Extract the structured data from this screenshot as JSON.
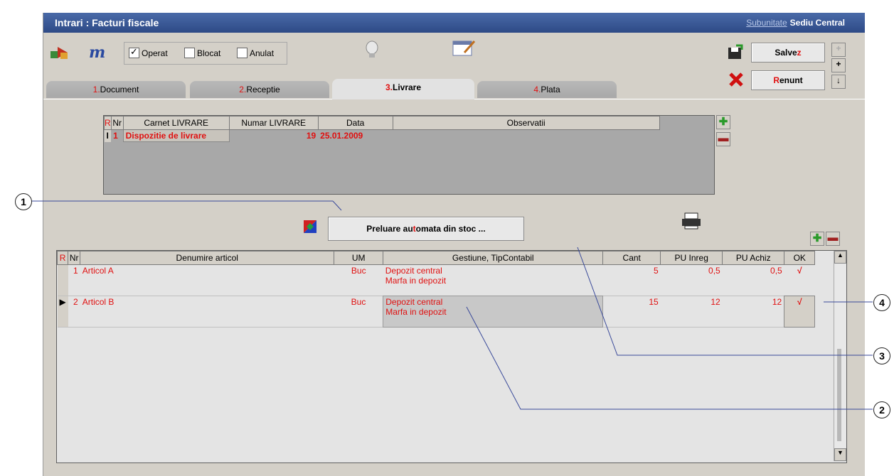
{
  "window": {
    "title": "Intrari : Facturi fiscale",
    "subunit_label": "Subunitate",
    "subunit_value": "Sediu Central"
  },
  "toolbar": {
    "checkboxes": [
      {
        "label": "Operat",
        "checked": true
      },
      {
        "label": "Blocat",
        "checked": false
      },
      {
        "label": "Anulat",
        "checked": false
      }
    ],
    "save_hot": "Salve",
    "save_rest": "z",
    "cancel_hot": "R",
    "cancel_rest": "enunt"
  },
  "tabs": [
    {
      "num": "1.",
      "label": "Document"
    },
    {
      "num": "2.",
      "label": "Receptie"
    },
    {
      "num": "3.",
      "label": "Livrare"
    },
    {
      "num": "4.",
      "label": "Plata"
    }
  ],
  "delivery_grid": {
    "headers": [
      "R",
      "Nr",
      "Carnet LIVRARE",
      "Numar LIVRARE",
      "Data",
      "Observatii"
    ],
    "rows": [
      {
        "r": "I",
        "nr": "1",
        "carnet": "Dispozitie de livrare",
        "numar": "19",
        "data": "25.01.2009",
        "obs": ""
      }
    ]
  },
  "auto_button": {
    "prefix": "Preluare au",
    "hot": "t",
    "suffix": "omata din stoc ..."
  },
  "items_grid": {
    "headers": [
      "R",
      "Nr",
      "Denumire articol",
      "UM",
      "Gestiune, TipContabil",
      "Cant",
      "PU Inreg",
      "PU Achiz",
      "OK"
    ],
    "rows": [
      {
        "nr": "1",
        "name": "Articol A",
        "um": "Buc",
        "gest1": "Depozit central",
        "gest2": "Marfa in depozit",
        "cant": "5",
        "pu_inreg": "0,5",
        "pu_achiz": "0,5",
        "ok": "√"
      },
      {
        "nr": "2",
        "name": "Articol B",
        "um": "Buc",
        "gest1": "Depozit central",
        "gest2": "Marfa in depozit",
        "cant": "15",
        "pu_inreg": "12",
        "pu_achiz": "12",
        "ok": "√"
      }
    ]
  },
  "callouts": [
    "1",
    "2",
    "3",
    "4"
  ],
  "colors": {
    "accent_red": "#e01010",
    "title_blue": "#2e4a86"
  }
}
